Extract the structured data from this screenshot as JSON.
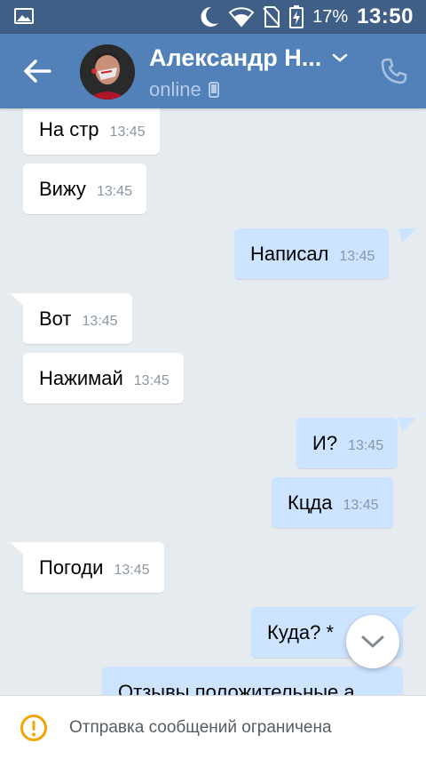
{
  "status_bar": {
    "battery_percent": "17%",
    "time": "13:50",
    "icons": [
      "image-notification-icon",
      "moon-icon",
      "wifi-icon",
      "no-sim-icon",
      "battery-charging-icon"
    ]
  },
  "header": {
    "contact_name": "Александр Н...",
    "status": "online",
    "icons": [
      "back-arrow-icon",
      "chevron-down-icon",
      "mobile-device-icon",
      "phone-icon"
    ]
  },
  "messages": [
    {
      "direction": "in",
      "text": "На стр",
      "time": "13:45"
    },
    {
      "direction": "in",
      "text": "Вижу",
      "time": "13:45"
    },
    {
      "direction": "out",
      "text": "Написал",
      "time": "13:45"
    },
    {
      "direction": "in",
      "text": "Вот",
      "time": "13:45"
    },
    {
      "direction": "in",
      "text": "Нажимай",
      "time": "13:45"
    },
    {
      "direction": "out",
      "text": "И?",
      "time": "13:45"
    },
    {
      "direction": "out",
      "text": "Кцда",
      "time": "13:45"
    },
    {
      "direction": "in",
      "text": "Погоди",
      "time": "13:45"
    },
    {
      "direction": "out",
      "text": "Куда? *",
      "time": ""
    },
    {
      "direction": "out",
      "text": "Отзывы положительные а",
      "time": ""
    }
  ],
  "scroll_down_icon": "chevron-down-icon",
  "bottom_bar": {
    "icon": "warning-circle-icon",
    "text": "Отправка сообщений ограничена"
  },
  "colors": {
    "status_bar": "#3f5f87",
    "header": "#5181b8",
    "background": "#e6ebf0",
    "incoming_bubble": "#ffffff",
    "outgoing_bubble": "#cce4ff",
    "warning": "#f2a400"
  }
}
